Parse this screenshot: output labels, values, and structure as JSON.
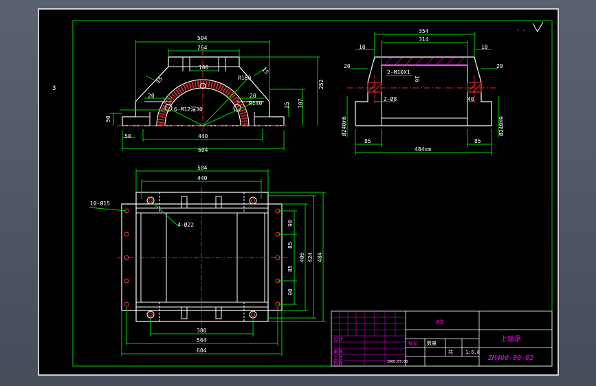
{
  "colors": {
    "viewport": "#4b5462",
    "paper": "#000000",
    "border": "#ffffff",
    "frame": "#00d400",
    "outline": "#ffffff",
    "dimension": "#00d400",
    "center_line": "#ff2020",
    "hatch": "#ff3030",
    "annotation": "#ff00ff",
    "cyan_text": "#00ffff"
  },
  "sheet_marker": "3",
  "front_view": {
    "dims": {
      "width_504": "504",
      "width_264": "264",
      "width_100": "100",
      "r160": "R160",
      "r140": "R140",
      "angle_15a": "15",
      "angle_15b": "15",
      "w20_left": "20",
      "w20_right": "20",
      "holes": "6-M12深30",
      "h252": "252",
      "h107": "107",
      "h25": "25",
      "h50": "50",
      "w50": "50",
      "w440": "440",
      "w604": "604"
    }
  },
  "side_view": {
    "dims": {
      "w354": "354",
      "w314": "314",
      "w10_left": "10",
      "w10_right": "10",
      "w20_left": "20",
      "w20_right": "20",
      "tap": "2-M10X1",
      "h16": "16",
      "pin": "2-Ø8",
      "w40": "40",
      "dia_left": "Ø240m6",
      "dia_right": "Ø240H9",
      "w85_left": "85",
      "w85_right": "85",
      "w484": "484±m"
    }
  },
  "top_view": {
    "dims": {
      "w504": "504",
      "w440": "440",
      "bolt_holes": "10-Ø15",
      "tap_holes": "4-Ø22",
      "v90a": "90",
      "v85a": "85",
      "v85b": "85",
      "v90b": "90",
      "h406": "406",
      "h424": "424",
      "h484": "484",
      "w380": "380",
      "w564": "564",
      "w604": "604"
    }
  },
  "title_block": {
    "paper_size": "A3",
    "part_name": "上轴承",
    "drawing_number": "ZM400-00-02",
    "scale": "1:6.8",
    "sheet_label": "共",
    "row_labels": [
      "设计",
      "审核",
      "工艺",
      "批准"
    ],
    "date": "2008.07.08",
    "mark_col": "标记",
    "qty": "数量"
  }
}
